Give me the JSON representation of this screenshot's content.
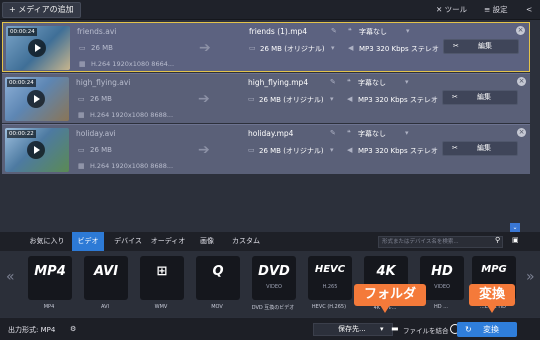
{
  "toolbar": {
    "add_media": "+ メディアの追加",
    "tools": "✕ ツール",
    "settings": "≡ 設定",
    "share": "<"
  },
  "files": [
    {
      "duration": "00:00:24",
      "source_name": "friends.avi",
      "source_size": "26 MB",
      "source_info": "H.264 1920x1080 8664...",
      "output_name": "friends (1).mp4",
      "output_size": "26 MB (オリジナル)",
      "subtitle": "字幕なし",
      "audio": "MP3 320 Kbps ステレオ",
      "edit": "編集"
    },
    {
      "duration": "00:00:24",
      "source_name": "high_flying.avi",
      "source_size": "26 MB",
      "source_info": "H.264 1920x1080 8688...",
      "output_name": "high_flying.mp4",
      "output_size": "26 MB (オリジナル)",
      "subtitle": "字幕なし",
      "audio": "MP3 320 Kbps ステレオ",
      "edit": "編集"
    },
    {
      "duration": "00:00:22",
      "source_name": "holiday.avi",
      "source_size": "26 MB",
      "source_info": "H.264 1920x1080 8688...",
      "output_name": "holiday.mp4",
      "output_size": "26 MB (オリジナル)",
      "subtitle": "字幕なし",
      "audio": "MP3 320 Kbps ステレオ",
      "edit": "編集"
    }
  ],
  "tabs": [
    "お気に入り",
    "ビデオ",
    "デバイス",
    "オーディオ",
    "画像",
    "カスタム"
  ],
  "search_placeholder": "形式またはデバイス名を検索...",
  "formats": [
    {
      "main": "MP4",
      "sub": "",
      "label": "MP4"
    },
    {
      "main": "AVI",
      "sub": "",
      "label": "AVI"
    },
    {
      "main": "⊞",
      "sub": "",
      "label": "WMV"
    },
    {
      "main": "Q",
      "sub": "",
      "label": "MOV"
    },
    {
      "main": "DVD",
      "sub": "VIDEO",
      "label": "DVD 互換のビデオ"
    },
    {
      "main": "HEVC",
      "sub": "H.265",
      "label": "HEVC (H.265)"
    },
    {
      "main": "4K",
      "sub": "",
      "label": "4K ウル..."
    },
    {
      "main": "HD",
      "sub": "VIDEO",
      "label": "HD ..."
    },
    {
      "main": "MPG",
      "sub": "",
      "label": "...EG-1 HD"
    }
  ],
  "bottom": {
    "output_format": "出力形式: MP4",
    "save_to": "保存先...",
    "merge": "ファイルを結合",
    "convert": "変換"
  },
  "callouts": {
    "folder": "フォルダ",
    "convert": "変換"
  },
  "colors": {
    "accent": "#2f7edb",
    "selection_border": "#e3c34a",
    "callout": "#f47a3a"
  }
}
